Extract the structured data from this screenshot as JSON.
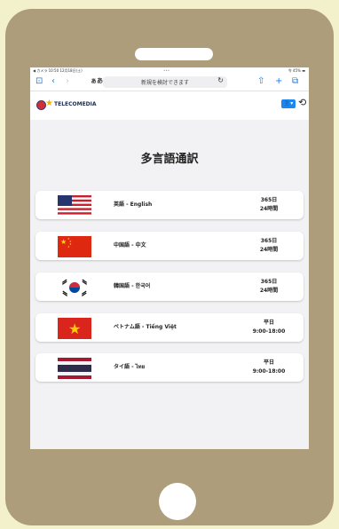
{
  "status_bar": {
    "left": "◀ カメラ  10:50  12月18日(土)",
    "center": "•••",
    "right": "令 45% ▬"
  },
  "browser": {
    "address_text": "新規を検討できます",
    "reader_label": "ぁあ"
  },
  "header": {
    "logo_text": "TELECOMEDIA"
  },
  "page": {
    "title": "多言語通訳"
  },
  "services": [
    {
      "flag": "us",
      "language": "英語 - English",
      "line1": "365日",
      "line2": "24時間"
    },
    {
      "flag": "cn",
      "language": "中国語 - 中文",
      "line1": "365日",
      "line2": "24時間"
    },
    {
      "flag": "kr",
      "language": "韓国語 - 한국어",
      "line1": "365日",
      "line2": "24時間"
    },
    {
      "flag": "vn",
      "language": "ベトナム語 - Tiếng Việt",
      "line1": "平日",
      "line2": "9:00-18:00"
    },
    {
      "flag": "th",
      "language": "タイ語 - ไทย",
      "line1": "平日",
      "line2": "9:00-18:00"
    }
  ],
  "colors": {
    "frame_background": "#f3f1cb",
    "device_body": "#ad9d7b",
    "accent_blue": "#1b88f1"
  }
}
